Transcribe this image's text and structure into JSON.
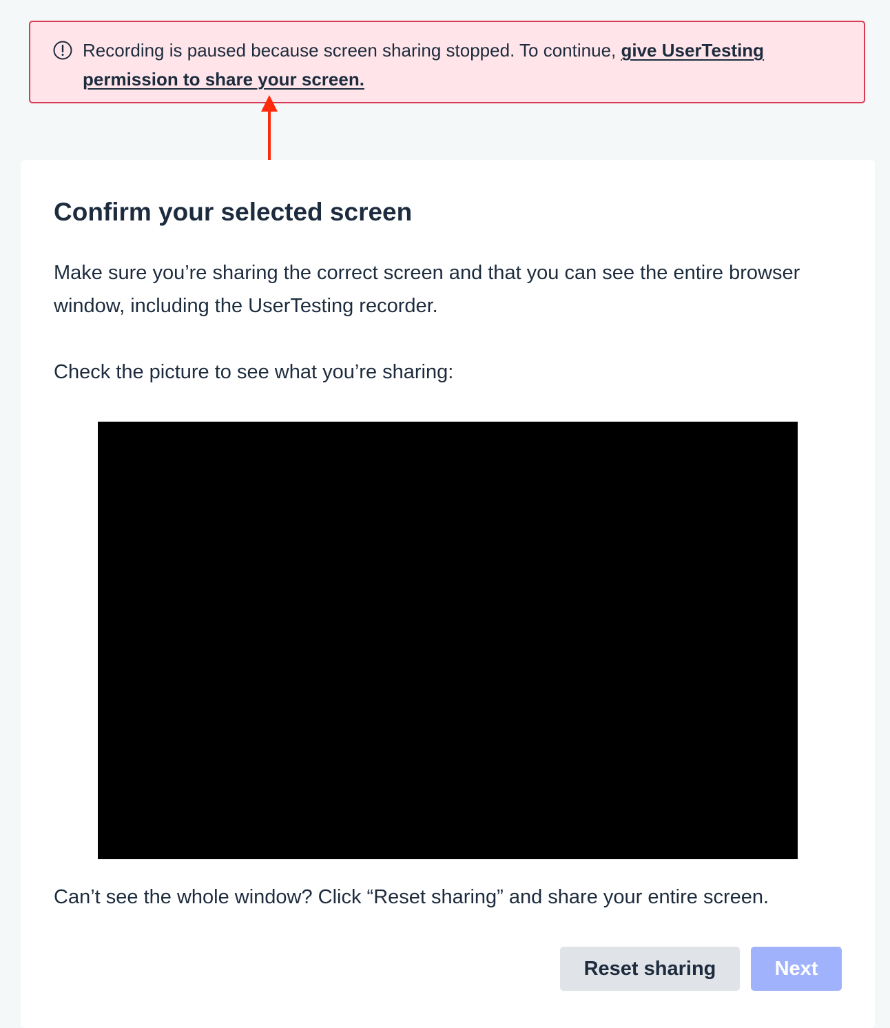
{
  "alert": {
    "icon": "exclamation-circle-icon",
    "message": "Recording is paused because screen sharing stopped. To continue, ",
    "link_text": "give UserTesting permission to share your screen.",
    "colors": {
      "background": "#ffe5e9",
      "border": "#d73a52"
    }
  },
  "annotation": {
    "icon": "red-arrow-up-icon",
    "color": "#ff2a0a"
  },
  "card": {
    "title": "Confirm your selected screen",
    "description": "Make sure you’re sharing the correct screen and that you can see the entire browser window, including the UserTesting recorder.",
    "check_prompt": "Check the picture to see what you’re sharing:",
    "hint": "Can’t see the whole window? Click “Reset sharing” and share your entire screen."
  },
  "buttons": {
    "reset_label": "Reset sharing",
    "next_label": "Next",
    "next_disabled": true
  }
}
